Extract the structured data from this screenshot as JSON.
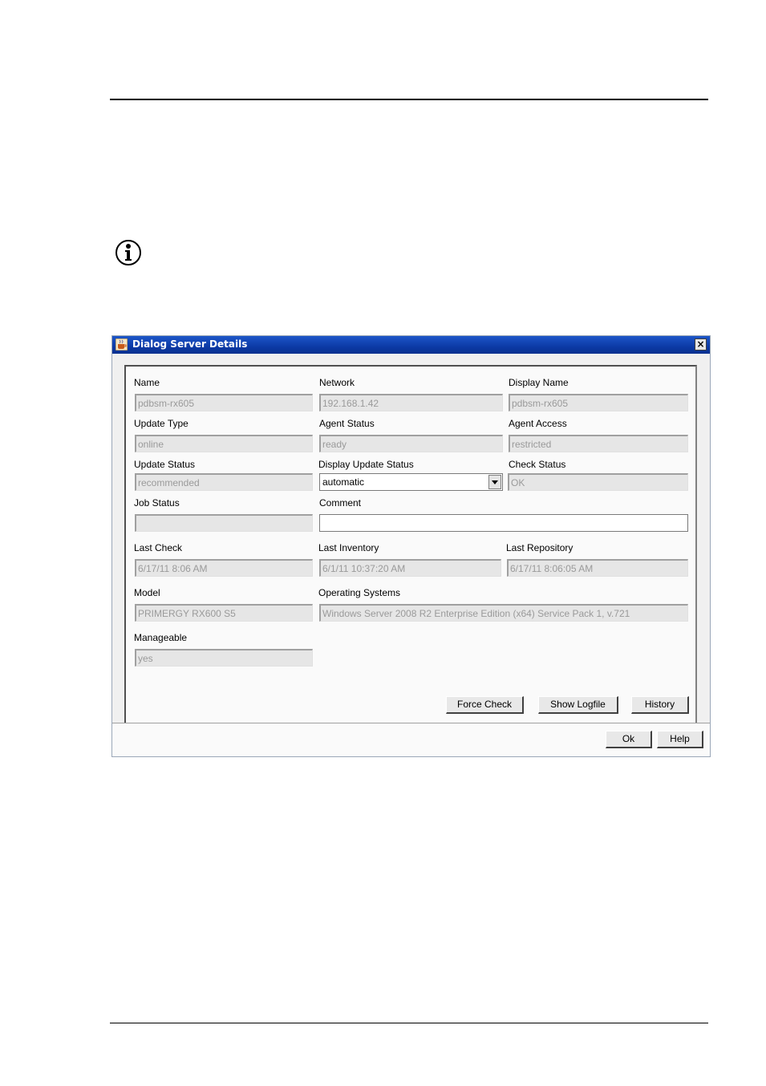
{
  "dialog": {
    "title": "Dialog Server Details",
    "close_label": "×"
  },
  "fields": {
    "name": {
      "label": "Name",
      "value": "pdbsm-rx605"
    },
    "network": {
      "label": "Network",
      "value": "192.168.1.42"
    },
    "display_name": {
      "label": "Display Name",
      "value": "pdbsm-rx605"
    },
    "update_type": {
      "label": "Update Type",
      "value": "online"
    },
    "agent_status": {
      "label": "Agent Status",
      "value": "ready"
    },
    "agent_access": {
      "label": "Agent Access",
      "value": "restricted"
    },
    "update_status": {
      "label": "Update Status",
      "value": "recommended"
    },
    "display_update_status": {
      "label": "Display Update Status",
      "value": "automatic"
    },
    "check_status": {
      "label": "Check Status",
      "value": "OK"
    },
    "job_status": {
      "label": "Job Status",
      "value": ""
    },
    "comment": {
      "label": "Comment",
      "value": ""
    },
    "last_check": {
      "label": "Last Check",
      "value": "6/17/11 8:06 AM"
    },
    "last_inventory": {
      "label": "Last Inventory",
      "value": "6/1/11 10:37:20 AM"
    },
    "last_repository": {
      "label": "Last Repository",
      "value": "6/17/11 8:06:05 AM"
    },
    "model": {
      "label": "Model",
      "value": "PRIMERGY RX600 S5"
    },
    "operating_systems": {
      "label": "Operating Systems",
      "value": "Windows Server 2008 R2 Enterprise Edition (x64) Service Pack 1, v.721"
    },
    "manageable": {
      "label": "Manageable",
      "value": "yes"
    }
  },
  "buttons": {
    "force_check": "Force Check",
    "show_logfile": "Show Logfile",
    "history": "History",
    "ok": "Ok",
    "help": "Help"
  },
  "icons": {
    "info": "info-icon",
    "app": "java-cup-icon",
    "close": "close-icon",
    "dropdown": "chevron-down-icon"
  }
}
